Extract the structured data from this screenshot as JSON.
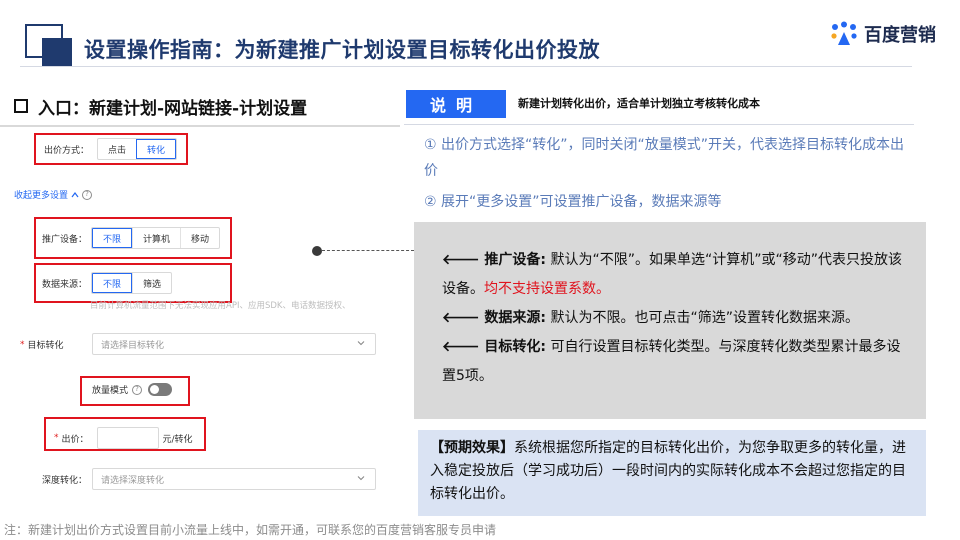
{
  "header": {
    "title": "设置操作指南：为新建推广计划设置目标转化出价投放",
    "logo_text": "百度营销"
  },
  "entry": {
    "label": "入口：新建计划-网站链接-计划设置"
  },
  "form": {
    "bid_method": {
      "label": "出价方式：",
      "options": [
        "点击",
        "转化"
      ],
      "selected": "转化"
    },
    "collapse_link": "收起更多设置",
    "device": {
      "label": "推广设备：",
      "options": [
        "不限",
        "计算机",
        "移动"
      ],
      "selected": "不限"
    },
    "data_source": {
      "label": "数据来源：",
      "options": [
        "不限",
        "筛选"
      ],
      "selected": "不限"
    },
    "data_source_hint": "目前计算机流量范围下无法实现应用API、应用SDK、电话数据授权、",
    "target_conversion": {
      "label": "目标转化",
      "placeholder": "请选择目标转化"
    },
    "volume_mode": {
      "label": "放量模式"
    },
    "bid": {
      "label": "出价：",
      "value": "",
      "unit": "元/转化"
    },
    "deep_conversion": {
      "label": "深度转化：",
      "placeholder": "请选择深度转化"
    }
  },
  "explain": {
    "tag": "说明",
    "headline": "新建计划转化出价，适合单计划独立考核转化成本",
    "point1": "① 出价方式选择“转化”，同时关闭“放量模式”开关，代表选择目标转化成本出价",
    "point2": "② 展开“更多设置”可设置推广设备，数据来源等"
  },
  "details": {
    "device_key": "推广设备:",
    "device_text": " 默认为“不限”。如果单选“计算机”或“移动”代表只投放该设备。",
    "device_warning": "均不支持设置系数。",
    "source_key": "数据来源:",
    "source_text": " 默认为不限。也可点击“筛选”设置转化数据来源。",
    "target_key": "目标转化:",
    "target_text": " 可自行设置目标转化类型。与深度转化数类型累计最多设置5项。"
  },
  "effect": {
    "key": "【预期效果】",
    "text": "系统根据您所指定的目标转化出价，为您争取更多的转化量，进入稳定投放后（学习成功后）一段时间内的实际转化成本不会超过您指定的目标转化出价。"
  },
  "footnote": "注：新建计划出价方式设置目前小流量上线中，如需开通，可联系您的百度营销客服专员申请",
  "colors": {
    "brand_blue": "#2468f2",
    "title_navy": "#1f3a6e",
    "highlight_red": "#e0141e"
  },
  "icons": [
    "baidu-logo-icon",
    "question-icon",
    "chevron-down-icon",
    "left-arrow-icon",
    "toggle-switch-icon"
  ]
}
